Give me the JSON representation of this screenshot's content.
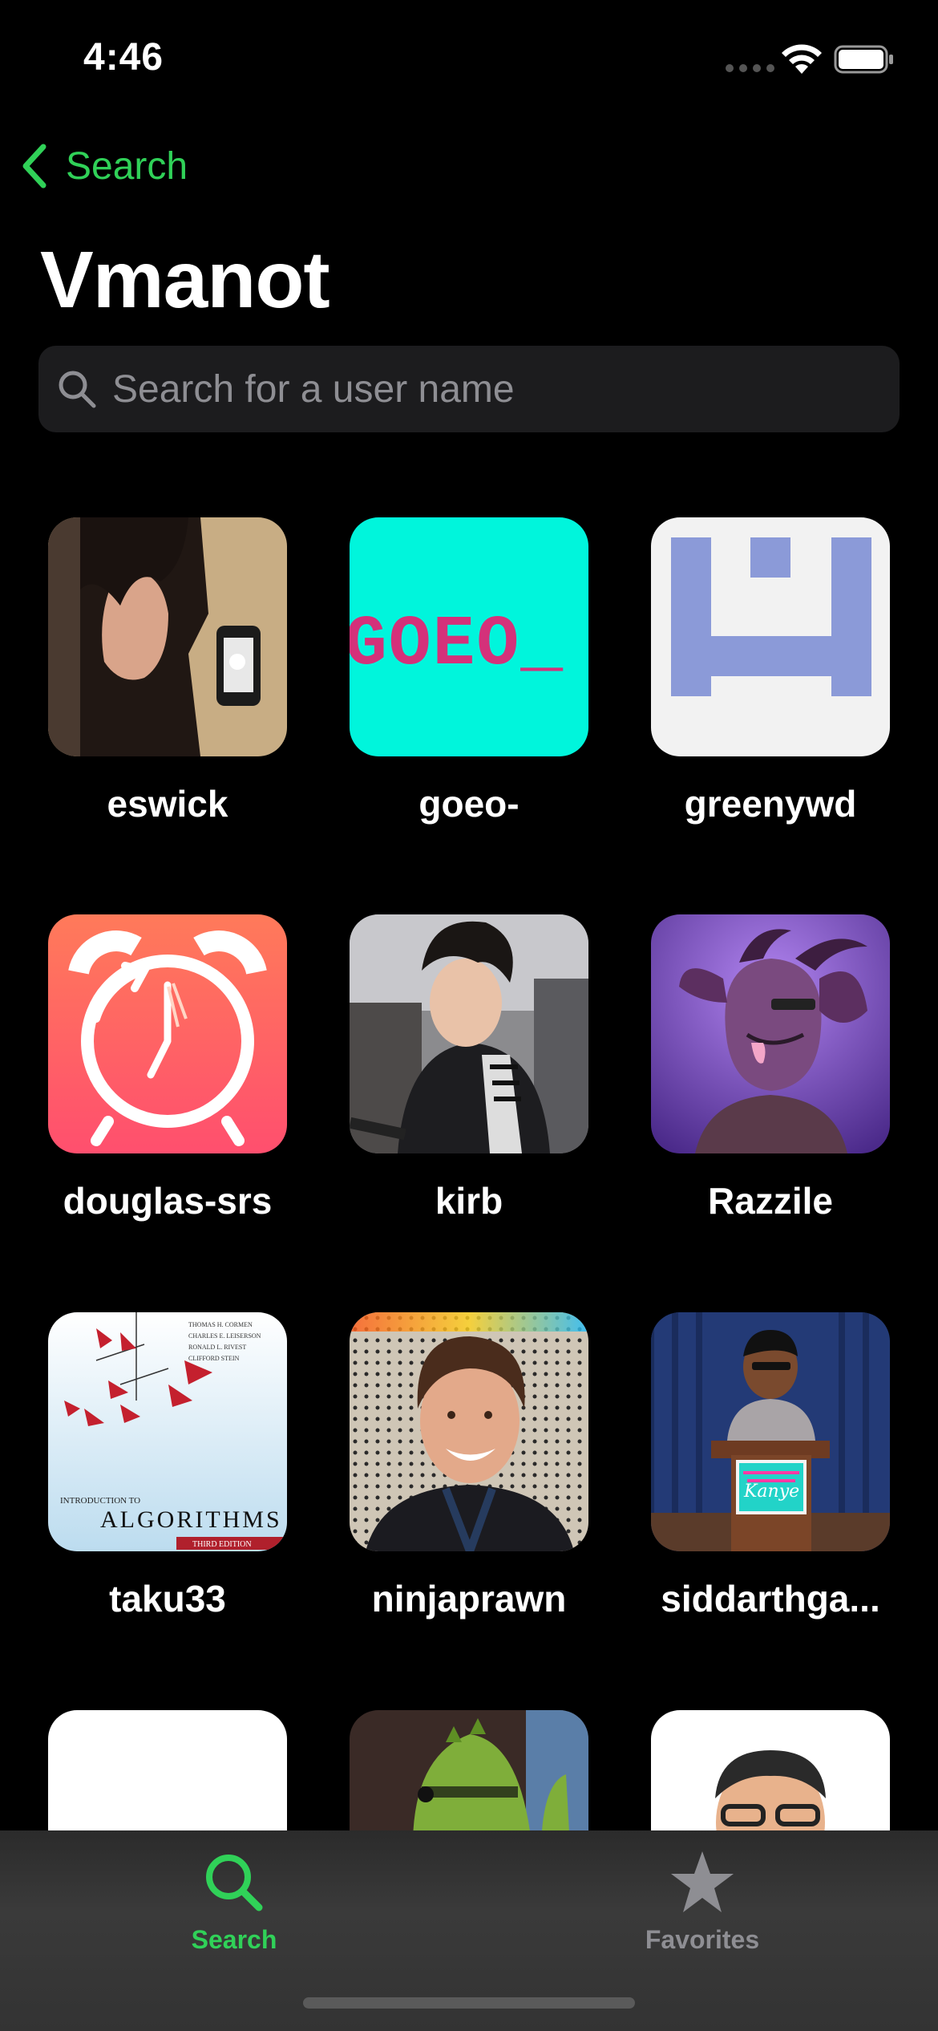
{
  "status_bar": {
    "time": "4:46"
  },
  "nav": {
    "back_label": "Search",
    "title": "Vmanot"
  },
  "search": {
    "placeholder": "Search for a user name",
    "value": ""
  },
  "users": [
    {
      "name": "eswick"
    },
    {
      "name": "goeo-"
    },
    {
      "name": "greenywd"
    },
    {
      "name": "douglas-srs"
    },
    {
      "name": "kirb"
    },
    {
      "name": "Razzile"
    },
    {
      "name": "taku33"
    },
    {
      "name": "ninjaprawn"
    },
    {
      "name": "siddarthga..."
    }
  ],
  "avatar_texts": {
    "goeo": "GOEO_",
    "algorithms": "ALGORITHMS",
    "intro": "INTRODUCTION TO",
    "edition": "THIRD EDITION",
    "authors": [
      "THOMAS H. CORMEN",
      "CHARLES E. LEISERSON",
      "RONALD L. RIVEST",
      "CLIFFORD STEIN"
    ],
    "kanye": "Kanye"
  },
  "tabs": [
    {
      "label": "Search",
      "icon": "search-icon",
      "active": true
    },
    {
      "label": "Favorites",
      "icon": "star-icon",
      "active": false
    }
  ],
  "colors": {
    "accent": "#30d158",
    "background": "#000000",
    "search_field": "#1c1c1e",
    "inactive_tab": "#8e8e93"
  }
}
